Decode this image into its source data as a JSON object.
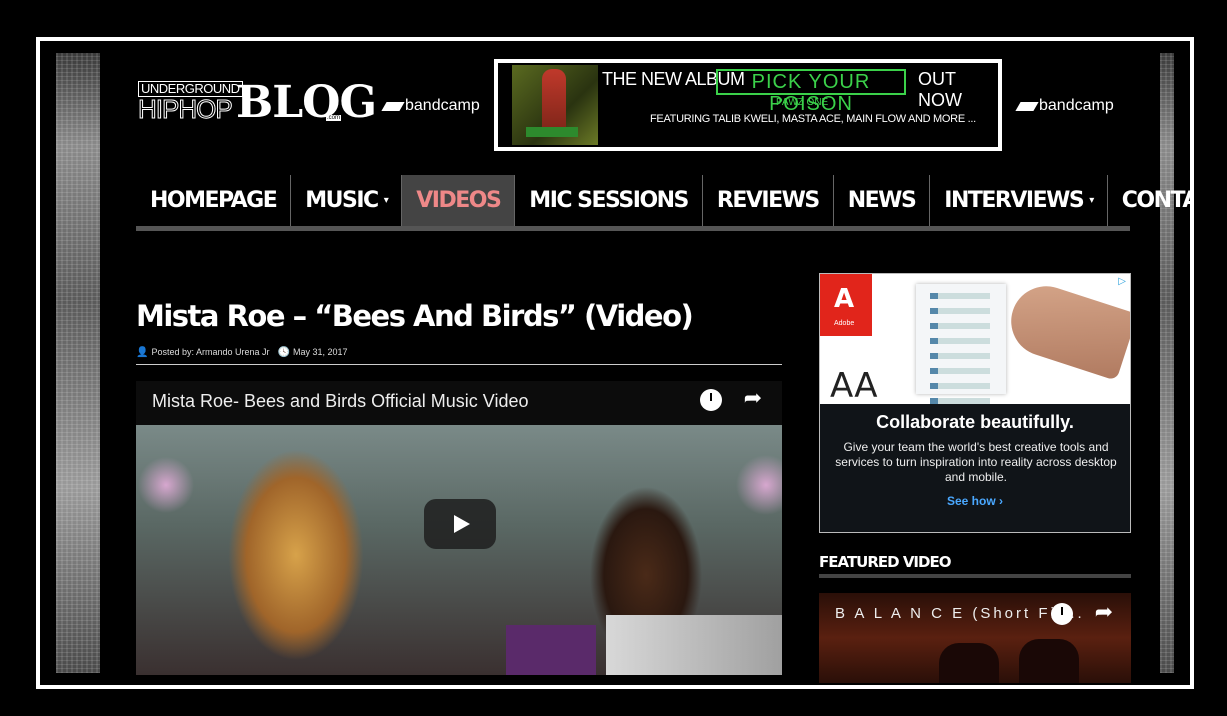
{
  "site": {
    "logo_top": "UNDERGROUND",
    "logo_mid": "HIPHOP",
    "logo_blog": "BLOG",
    "logo_com": ".com"
  },
  "header": {
    "bandcamp_left": "bandcamp",
    "bandcamp_right": "bandcamp",
    "banner": {
      "line1_prefix": "THE NEW ALBUM",
      "album_title": "PICK YOUR POISON",
      "line1_suffix": "OUT NOW",
      "artist": "PAWZ ONE",
      "featuring": "FEATURING TALIB KWELI, MASTA ACE, MAIN FLOW AND MORE ..."
    }
  },
  "nav": {
    "items": [
      {
        "label": "HOMEPAGE",
        "dropdown": false,
        "active": false
      },
      {
        "label": "MUSIC",
        "dropdown": true,
        "active": false
      },
      {
        "label": "VIDEOS",
        "dropdown": false,
        "active": true
      },
      {
        "label": "MIC SESSIONS",
        "dropdown": false,
        "active": false
      },
      {
        "label": "REVIEWS",
        "dropdown": false,
        "active": false
      },
      {
        "label": "NEWS",
        "dropdown": false,
        "active": false
      },
      {
        "label": "INTERVIEWS",
        "dropdown": true,
        "active": false
      },
      {
        "label": "CONTACT US",
        "dropdown": false,
        "active": false
      }
    ],
    "caret": "▾"
  },
  "article": {
    "title": "Mista Roe – “Bees And Birds” (Video)",
    "posted_by": "Posted by: Armando Urena Jr",
    "date": "May 31, 2017",
    "video_title": "Mista Roe- Bees and Birds Official Music Video"
  },
  "sidebar": {
    "ad": {
      "brand": "Adobe",
      "brand_letter": "A",
      "adchoices": "▷",
      "aa_text": "AA",
      "headline": "Collaborate beautifully.",
      "body": "Give your team the world's best creative tools and services to turn inspiration into reality across desktop and mobile.",
      "cta": "See how ›"
    },
    "featured_heading": "FEATURED VIDEO",
    "featured_video_title": "B A L A N C E (Short Fil..."
  },
  "colors": {
    "nav_active_bg": "#444444",
    "nav_active_text": "#ee8888",
    "banner_green": "#3bd14a",
    "adobe_red": "#e1251b",
    "cta_blue": "#4aa8ff"
  }
}
